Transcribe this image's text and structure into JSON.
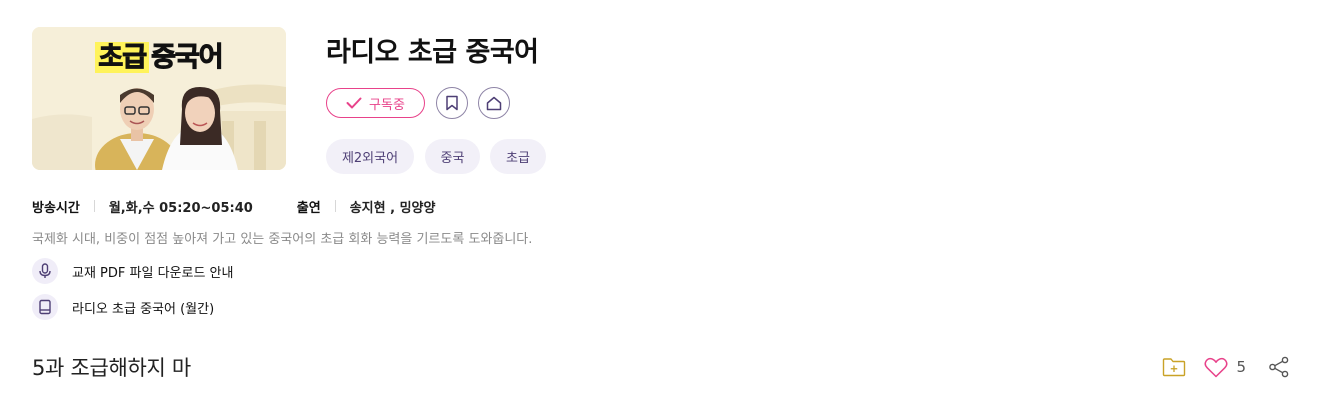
{
  "program": {
    "title": "라디오 초급 중국어",
    "thumbnail": {
      "title_highlight": "초급",
      "title_rest": "중국어"
    },
    "subscribe_label": "구독중",
    "tags": [
      "제2외국어",
      "중국",
      "초급"
    ]
  },
  "info": {
    "airtime_label": "방송시간",
    "airtime_value": "월,화,수 05:20~05:40",
    "cast_label": "출연",
    "cast_value": "송지현 , 밍양양"
  },
  "description": "국제화 시대, 비중이 점점 높아져 가고 있는 중국어의 초급 회화 능력을 기르도록 도와줍니다.",
  "links": [
    {
      "icon": "microphone-icon",
      "label": "교재 PDF 파일 다운로드 안내"
    },
    {
      "icon": "book-icon",
      "label": "라디오 초급 중국어 (월간)"
    }
  ],
  "episode": {
    "title": "5과 조급해하지 마",
    "like_count": "5"
  },
  "colors": {
    "accent_pink": "#e8428a",
    "tag_bg": "#f2f0f8",
    "folder_gold": "#c9a227"
  }
}
